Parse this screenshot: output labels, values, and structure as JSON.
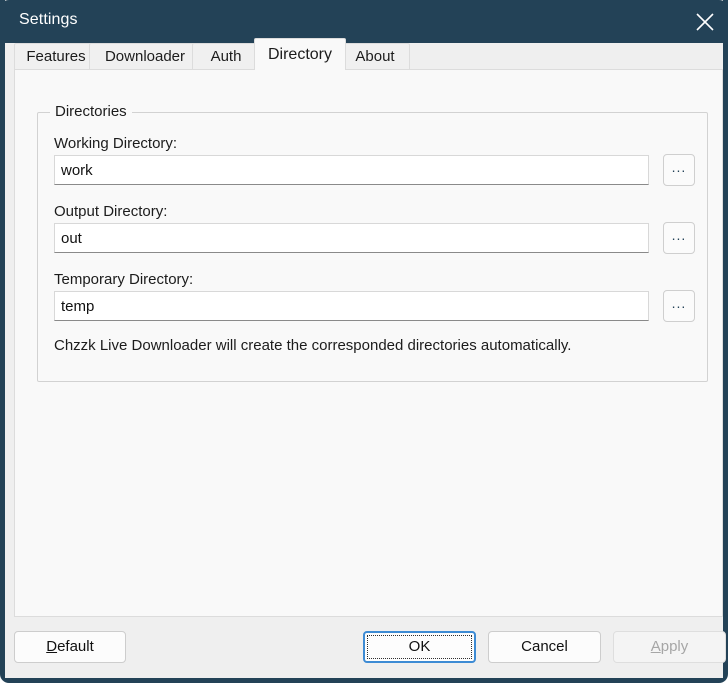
{
  "window": {
    "title": "Settings",
    "close_icon": "close-x-icon",
    "titlebar_color": "#234257",
    "accent_color": "#3d8bd4"
  },
  "tabs": [
    {
      "label": "Features",
      "selected": false
    },
    {
      "label": "Downloader",
      "selected": false
    },
    {
      "label": "Auth",
      "selected": false
    },
    {
      "label": "Directory",
      "selected": true
    },
    {
      "label": "About",
      "selected": false
    }
  ],
  "directory_tab": {
    "group_title": "Directories",
    "fields": [
      {
        "label": "Working Directory:",
        "value": "work",
        "browse_label": "..."
      },
      {
        "label": "Output Directory:",
        "value": "out",
        "browse_label": "..."
      },
      {
        "label": "Temporary Directory:",
        "value": "temp",
        "browse_label": "..."
      }
    ],
    "hint": "Chzzk Live Downloader will create the corresponded directories automatically."
  },
  "buttons": {
    "default": {
      "label": "Default",
      "mnemonic": "D",
      "rest": "efault",
      "disabled": false
    },
    "ok": {
      "label": "OK",
      "disabled": false,
      "focused": true
    },
    "cancel": {
      "label": "Cancel",
      "disabled": false
    },
    "apply": {
      "label": "Apply",
      "mnemonic": "A",
      "rest": "pply",
      "disabled": true
    }
  }
}
